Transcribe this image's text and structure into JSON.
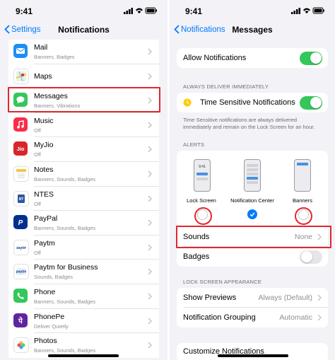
{
  "status": {
    "time": "9:41"
  },
  "left": {
    "nav": {
      "back": "Settings",
      "title": "Notifications"
    },
    "apps": [
      {
        "name": "Mail",
        "sub": "Banners, Badges",
        "icon": "mail-icon",
        "color": "#1e8ef5"
      },
      {
        "name": "Maps",
        "sub": "",
        "icon": "maps-icon",
        "color": "#ffffff"
      },
      {
        "name": "Messages",
        "sub": "Banners, Vibrations",
        "icon": "messages-icon",
        "color": "#34c759"
      },
      {
        "name": "Music",
        "sub": "Off",
        "icon": "music-icon",
        "color": "#fa2d48"
      },
      {
        "name": "MyJio",
        "sub": "Off",
        "icon": "myjio-icon",
        "color": "#d7262a"
      },
      {
        "name": "Notes",
        "sub": "Banners, Sounds, Badges",
        "icon": "notes-icon",
        "color": "#ffffff"
      },
      {
        "name": "NTES",
        "sub": "Off",
        "icon": "ntes-icon",
        "color": "#ffffff"
      },
      {
        "name": "PayPal",
        "sub": "Banners, Sounds, Badges",
        "icon": "paypal-icon",
        "color": "#00308f"
      },
      {
        "name": "Paytm",
        "sub": "Off",
        "icon": "paytm-icon",
        "color": "#ffffff"
      },
      {
        "name": "Paytm for Business",
        "sub": "Sounds, Badges",
        "icon": "paytm-business-icon",
        "color": "#ffffff"
      },
      {
        "name": "Phone",
        "sub": "Banners, Sounds, Badges",
        "icon": "phone-icon",
        "color": "#34c759"
      },
      {
        "name": "PhonePe",
        "sub": "Deliver Quietly",
        "icon": "phonepe-icon",
        "color": "#5f259f"
      },
      {
        "name": "Photos",
        "sub": "Banners, Sounds, Badges",
        "icon": "photos-icon",
        "color": "#ffffff"
      }
    ]
  },
  "right": {
    "nav": {
      "back": "Notifications",
      "title": "Messages"
    },
    "allow_notifications": {
      "label": "Allow Notifications",
      "on": true
    },
    "always_header": "ALWAYS DELIVER IMMEDIATELY",
    "time_sensitive": {
      "label": "Time Sensitive Notifications",
      "on": true
    },
    "time_sensitive_note": "Time Sensitive notifications are always delivered immediately and remain on the Lock Screen for an hour.",
    "alerts_header": "ALERTS",
    "alerts": [
      {
        "label": "Lock Screen",
        "selected": false,
        "phone_time": "9:41"
      },
      {
        "label": "Notification Center",
        "selected": true,
        "phone_time": ""
      },
      {
        "label": "Banners",
        "selected": false,
        "phone_time": ""
      }
    ],
    "sounds": {
      "label": "Sounds",
      "value": "None"
    },
    "badges": {
      "label": "Badges",
      "on": false
    },
    "lock_header": "LOCK SCREEN APPEARANCE",
    "show_previews": {
      "label": "Show Previews",
      "value": "Always (Default)"
    },
    "grouping": {
      "label": "Notification Grouping",
      "value": "Automatic"
    },
    "customize": {
      "label": "Customize Notifications"
    }
  }
}
